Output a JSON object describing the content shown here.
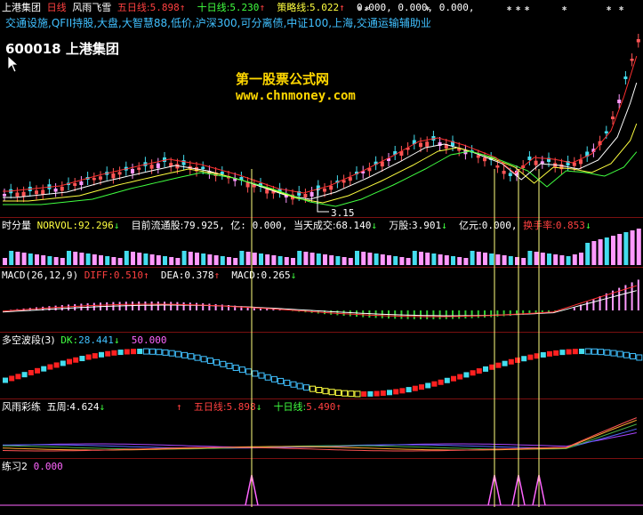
{
  "main_header": {
    "stock": "上港集团",
    "indicator": "日线",
    "formula": "风雨飞雪",
    "ma5_label": "五日线:",
    "ma5_value": "5.898",
    "ma10_label": "十日线:",
    "ma10_value": "5.230",
    "strategy_label": "策略线:",
    "strategy_value": "5.022",
    "zeros": "0.000, 0.000, 0.000,"
  },
  "concepts": "交通设施,QFII持股,大盘,大智慧88,低价,沪深300,可分离债,中证100,上海,交通运输辅助业",
  "code_title": "600018 上港集团",
  "watermark": {
    "line1": "第一股票公式网",
    "line2": "www.chnmoney.com"
  },
  "low_marker": "3.15",
  "volume_header": {
    "name": "时分量",
    "norvol_label": "NORVOL:",
    "norvol_value": "92.296",
    "float_label": "目前流通股:",
    "float_value": "79.925, 亿:",
    "float_value2": "0.000,",
    "deal_label": "当天成交:",
    "deal_value": "68.140",
    "wan_label": "万股:",
    "wan_value": "3.901",
    "yi_label": "亿元:",
    "yi_value": "0.000,",
    "turnover_label": "换手率:",
    "turnover_value": "0.853"
  },
  "macd_header": {
    "name": "MACD(26,12,9)",
    "diff_label": "DIFF:",
    "diff_value": "0.510",
    "dea_label": "DEA:",
    "dea_value": "0.378",
    "macd_label": "MACD:",
    "macd_value": "0.265"
  },
  "wave_header": {
    "name": "多空波段(3)",
    "dk_label": "DK:",
    "dk_value": "28.441",
    "val2": "50.000"
  },
  "rain_header": {
    "name": "风雨彩练",
    "week_label": "五周:",
    "week_value": "4.624",
    "ma5_label": "五日线:",
    "ma5_value": "5.898",
    "ma10_label": "十日线:",
    "ma10_value": "5.490"
  },
  "practice_header": {
    "name": "练习2",
    "value": "0.000"
  },
  "colors": {
    "up": "#ff5555",
    "down": "#44ddee",
    "ma_yellow": "#ffff40",
    "ma_white": "#ffffff",
    "ma_red": "#ff3030",
    "ma_green": "#40ff40",
    "vline": "#ffff80",
    "pink": "#ff99ff",
    "grid": "#7a1010"
  }
}
